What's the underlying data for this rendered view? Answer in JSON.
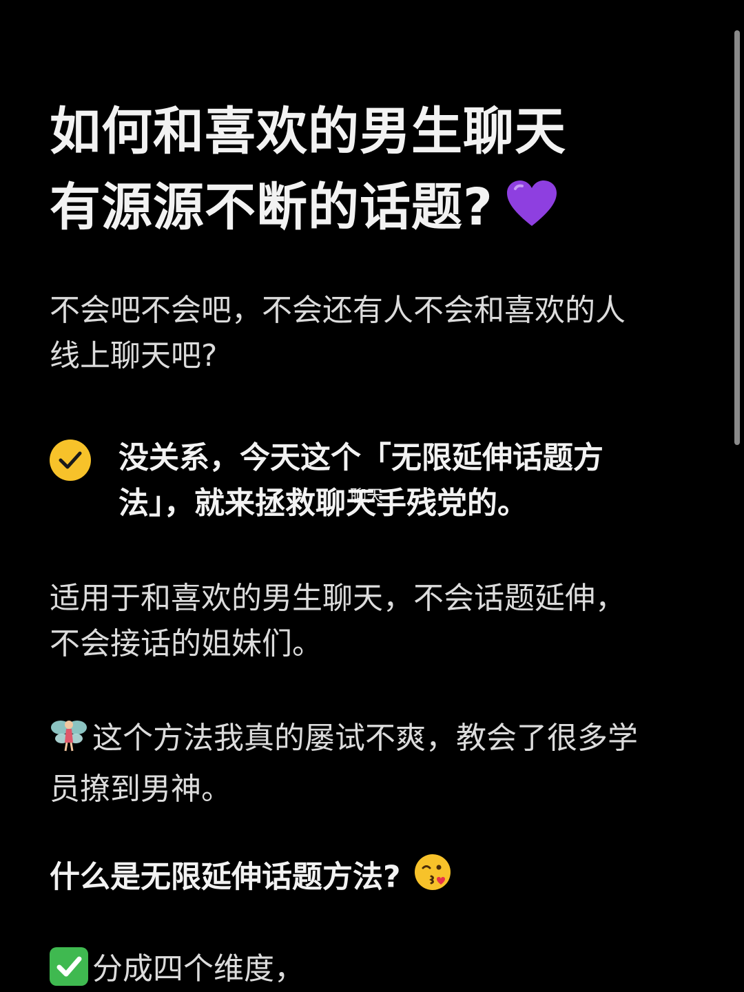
{
  "title": {
    "line1": "如何和喜欢的男生聊天",
    "line2": "有源源不断的话题?"
  },
  "intro": {
    "line1": "不会吧不会吧，不会还有人不会和喜欢的人",
    "line2": "线上聊天吧?"
  },
  "check_note": {
    "line1": "没关系，今天这个「无限延伸话题方",
    "line2": "法」，就来拯救聊天手残党的。"
  },
  "watermark": "聊天",
  "applies": {
    "line1": "适用于和喜欢的男生聊天，不会话题延伸，",
    "line2": "不会接话的姐妹们。"
  },
  "method": {
    "line1": "这个方法我真的屡试不爽，教会了很多学",
    "line2": "员撩到男神。"
  },
  "question": "什么是无限延伸话题方法?",
  "dimension": "分成四个维度，",
  "icons": {
    "heart": "purple-heart-icon",
    "check": "yellow-check-icon",
    "fairy": "fairy-icon",
    "kiss": "kiss-face-icon",
    "green_check": "green-check-icon"
  },
  "colors": {
    "background": "#000000",
    "check_yellow": "#f7c22a",
    "heart_purple": "#8e3fe0",
    "green_check": "#3fb950"
  }
}
